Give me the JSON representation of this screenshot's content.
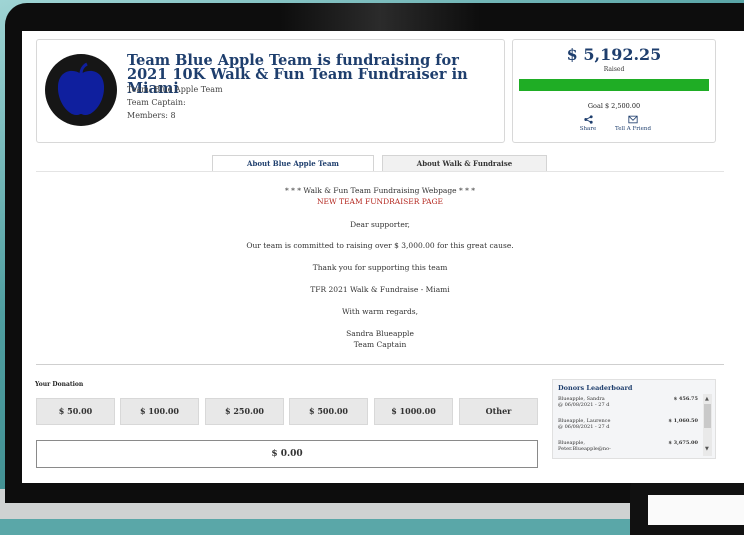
{
  "campaign": {
    "title": "Team Blue Apple Team is fundraising for 2021 10K Walk & Fun Team Fundraiser in Miami",
    "team": "Team: Blue Apple Team",
    "captain": "Team Captain:",
    "members": "Members: 8"
  },
  "fundraising": {
    "raised_amount": "$ 5,192.25",
    "raised_label": "Raised",
    "goal": "Goal   $ 2,500.00",
    "progress_fraction": 1.0,
    "progress_color": "#1fad25",
    "share_label": "Share",
    "tell_label": "Tell A Friend"
  },
  "tabs": [
    {
      "label": "About Blue Apple Team",
      "active": true
    },
    {
      "label": "About Walk & Fundraise",
      "active": false
    }
  ],
  "about": {
    "heading": "* * *  Walk & Fun Team Fundraising Webpage * * *",
    "subheading": "NEW TEAM FUNDRAISER PAGE",
    "greeting": "Dear supporter,",
    "goal_line": "Our team is committed to raising over $ 3,000.00 for this great cause.",
    "thanks": "Thank you for supporting this team",
    "event": "TFR 2021 Walk & Fundraise - Miami",
    "regards": "With warm regards,",
    "signer": "Sandra Blueapple",
    "signer_role": "Team Captain"
  },
  "donation": {
    "label": "Your Donation",
    "amounts": [
      "$ 50.00",
      "$ 100.00",
      "$ 250.00",
      "$ 500.00",
      "$ 1000.00",
      "Other"
    ],
    "custom_amount": "$ 0.00"
  },
  "leaderboard": {
    "title": "Donors Leaderboard",
    "donors": [
      {
        "name": "Blueapple, Sandra",
        "date": "@ 06/08/2021 - 27 d",
        "amount": "$ 456.75"
      },
      {
        "name": "Blueapple, Laurence",
        "date": "@ 06/08/2021 - 27 d",
        "amount": "$ 1,060.50"
      },
      {
        "name": "Blueapple,",
        "date": "Peter.Blueapple@no-",
        "amount": "$ 3,675.00"
      }
    ]
  },
  "colors": {
    "brand": "#1e3e6d",
    "accent_red": "#b3261e"
  }
}
